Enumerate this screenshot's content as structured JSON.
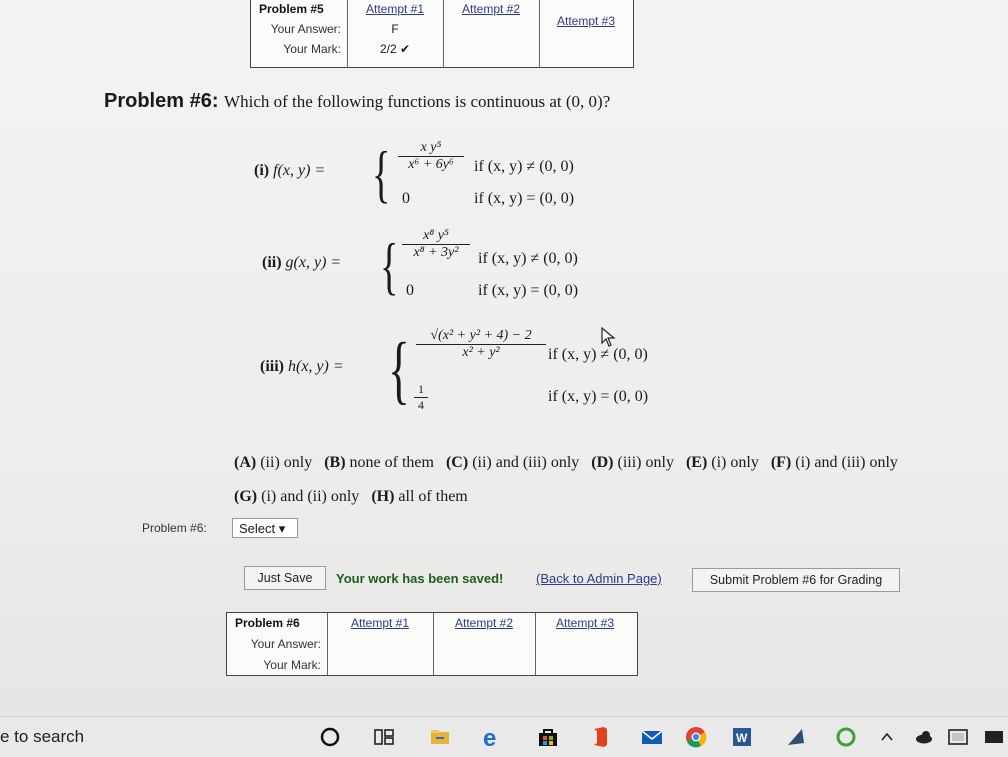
{
  "top_table": {
    "header": "Problem #5",
    "attempts": [
      "Attempt #1",
      "Attempt #2",
      "Attempt #3"
    ],
    "answer_label": "Your Answer:",
    "mark_label": "Your Mark:",
    "answer_values": [
      "F",
      "",
      ""
    ],
    "mark_values": [
      "2/2 ✔",
      "",
      ""
    ]
  },
  "problem": {
    "label": "Problem #6:",
    "question": "Which of the following functions is continuous at (0, 0)?",
    "functions": [
      {
        "label": "(i)",
        "name": "f(x, y) =",
        "num": "x y⁵",
        "den": "x⁶ + 6y⁶",
        "case1": "if (x, y) ≠ (0, 0)",
        "val2": "0",
        "case2": "if (x, y) = (0, 0)"
      },
      {
        "label": "(ii)",
        "name": "g(x, y) =",
        "num": "x⁸ y⁵",
        "den": "x⁸ + 3y²",
        "case1": "if (x, y) ≠ (0, 0)",
        "val2": "0",
        "case2": "if (x, y) = (0, 0)"
      },
      {
        "label": "(iii)",
        "name": "h(x, y) =",
        "num": "√(x² + y² + 4) − 2",
        "den": "x² + y²",
        "case1": "if (x, y) ≠ (0, 0)",
        "val2_num": "1",
        "val2_den": "4",
        "case2": "if (x, y) = (0, 0)"
      }
    ],
    "choices": [
      {
        "letter": "(A)",
        "text": "(ii) only"
      },
      {
        "letter": "(B)",
        "text": "none of them"
      },
      {
        "letter": "(C)",
        "text": "(ii) and (iii) only"
      },
      {
        "letter": "(D)",
        "text": "(iii) only"
      },
      {
        "letter": "(E)",
        "text": "(i) only"
      },
      {
        "letter": "(F)",
        "text": "(i) and (iii) only"
      },
      {
        "letter": "(G)",
        "text": "(i) and (ii) only"
      },
      {
        "letter": "(H)",
        "text": "all of them"
      }
    ]
  },
  "answer": {
    "label": "Problem #6:",
    "select_value": "Select ▾"
  },
  "actions": {
    "just_save": "Just Save",
    "saved_message": "Your work has been saved!",
    "back_link": "(Back to Admin Page)",
    "submit": "Submit Problem #6 for Grading"
  },
  "bottom_table": {
    "header": "Problem #6",
    "attempts": [
      "Attempt #1",
      "Attempt #2",
      "Attempt #3"
    ],
    "answer_label": "Your Answer:",
    "mark_label": "Your Mark:"
  },
  "taskbar": {
    "search_text": "e to search",
    "icons": [
      "cortana-icon",
      "task-view-icon",
      "file-explorer-icon",
      "edge-icon",
      "store-icon",
      "office-icon",
      "mail-icon",
      "chrome-icon",
      "word-icon",
      "app-icon",
      "sync-icon",
      "chevron-up-icon",
      "onedrive-icon",
      "network-icon",
      "notification-icon"
    ]
  },
  "colors": {
    "link": "#2a3c8a",
    "saved": "#1d5d1d"
  }
}
